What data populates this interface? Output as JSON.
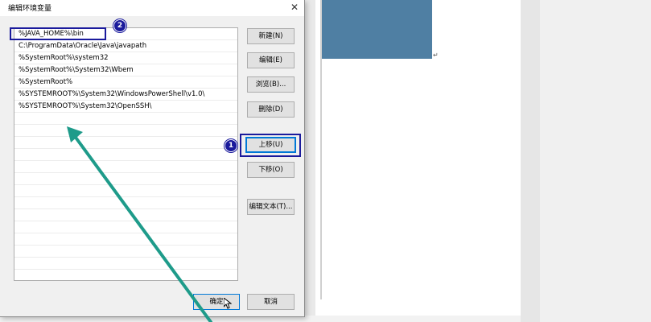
{
  "dialog": {
    "title": "编辑环境变量",
    "close_glyph": "✕",
    "paths": [
      "%JAVA_HOME%\\bin",
      "C:\\ProgramData\\Oracle\\Java\\javapath",
      "%SystemRoot%\\system32",
      "%SystemRoot%\\System32\\Wbem",
      "%SystemRoot%",
      "%SYSTEMROOT%\\System32\\WindowsPowerShell\\v1.0\\",
      "%SYSTEMROOT%\\System32\\OpenSSH\\"
    ],
    "buttons": {
      "new": "新建(N)",
      "edit": "编辑(E)",
      "browse": "浏览(B)...",
      "delete": "删除(D)",
      "move_up": "上移(U)",
      "move_down": "下移(O)",
      "edit_text": "编辑文本(T)...",
      "ok": "确定",
      "cancel": "取消"
    }
  },
  "annotations": {
    "badge_1": "1",
    "badge_2": "2",
    "annotation_color": "#1a1a9c",
    "arrow_color": "#1e9b8a"
  },
  "background": {
    "paragraph_mark": "↵",
    "image_color": "#4f7fa3"
  }
}
